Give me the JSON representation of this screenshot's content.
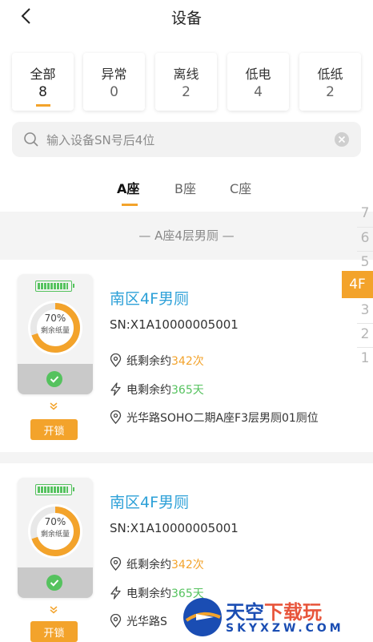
{
  "header": {
    "title": "设备"
  },
  "categories": [
    {
      "label": "全部",
      "count": "8"
    },
    {
      "label": "异常",
      "count": "0"
    },
    {
      "label": "离线",
      "count": "2"
    },
    {
      "label": "低电",
      "count": "4"
    },
    {
      "label": "低纸",
      "count": "2"
    }
  ],
  "search": {
    "placeholder": "输入设备SN号后4位"
  },
  "tabs": [
    "A座",
    "B座",
    "C座"
  ],
  "section_title": "— A座4层男厕 —",
  "devices": [
    {
      "name": "南区4F男厕",
      "sn": "SN:X1A10000005001",
      "paper_label": "纸剩余约",
      "paper_value": "342次",
      "power_label": "电剩余约",
      "power_value": "365天",
      "location": "光华路SOHO二期A座F3层男厕01厕位",
      "paper_percent": "70%",
      "paper_caption": "剩余纸量",
      "unlock_label": "开锁"
    },
    {
      "name": "南区4F男厕",
      "sn": "SN:X1A10000005001",
      "paper_label": "纸剩余约",
      "paper_value": "342次",
      "power_label": "电剩余约",
      "power_value": "365天",
      "location": "光华路S",
      "paper_percent": "70%",
      "paper_caption": "剩余纸量",
      "unlock_label": "开锁"
    }
  ],
  "floor_index": {
    "items": [
      "7",
      "6",
      "5",
      "3",
      "2",
      "1"
    ],
    "active": "4F"
  },
  "watermark": {
    "main_a": "天空",
    "main_b": "下载玩",
    "sub": "SKYXZW.COM"
  },
  "colors": {
    "accent": "#f3a32b",
    "title_blue": "#2ea1d8",
    "green": "#55c25e"
  }
}
